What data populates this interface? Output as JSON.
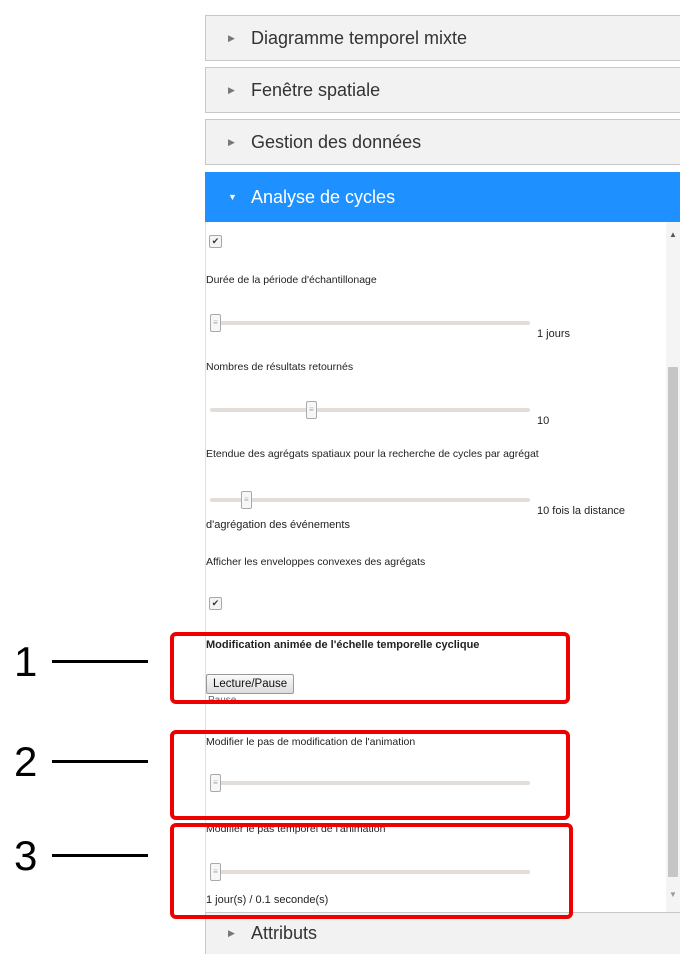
{
  "accordion": [
    {
      "label": "Diagramme temporel mixte",
      "active": false
    },
    {
      "label": "Fenêtre spatiale",
      "active": false
    },
    {
      "label": "Gestion des données",
      "active": false
    },
    {
      "label": "Analyse de cycles",
      "active": true
    },
    {
      "label": "Attributs",
      "active": false
    }
  ],
  "panel": {
    "checkbox_top_checked": true,
    "sampling_label": "Durée de la période d'échantillonage",
    "sampling_value": "1 jours",
    "results_label": "Nombres de résultats retournés",
    "results_value": "10",
    "extent_label": "Etendue des agrégats spatiaux pour la recherche de cycles par agrégat",
    "extent_value": "10 fois la distance",
    "extent_value_cont": "d'agrégation des événements",
    "hull_label": "Afficher les enveloppes convexes des agrégats",
    "hull_checked": true,
    "animation_title": "Modification animée de l'échelle temporelle cyclique",
    "play_button": "Lecture/Pause",
    "play_status": "Pause",
    "step_label": "Modifier le pas de modification de l'animation",
    "temporal_step_label": "Modifier le pas temporel de l'animation",
    "temporal_step_value": "1 jour(s) / 0.1 seconde(s)"
  },
  "sliders": {
    "sampling": 0.0,
    "results": 0.31,
    "extent": 0.1,
    "step": 0.0,
    "temporal_step": 0.0
  },
  "annotations": [
    "1",
    "2",
    "3"
  ],
  "colors": {
    "accent": "#1e90ff",
    "annotation": "#ee0000"
  },
  "icons": {
    "collapsed": "triangle-right-icon",
    "expanded": "triangle-down-icon"
  }
}
